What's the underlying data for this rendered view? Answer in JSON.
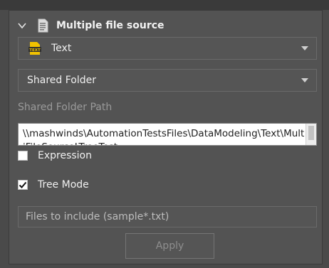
{
  "section": {
    "title": "Multiple file source",
    "collapse_icon": "chevron-down-icon",
    "title_icon": "document-icon"
  },
  "source_type": {
    "icon": "text-file-icon",
    "value": "Text"
  },
  "location_type": {
    "value": "Shared Folder"
  },
  "shared_folder": {
    "label": "Shared Folder Path",
    "value": "\\\\mashwinds\\AutomationTestsFiles\\DataModeling\\Text\\MultiFileSourceLTreeTest"
  },
  "options": {
    "expression": {
      "label": "Expression",
      "checked": false
    },
    "tree_mode": {
      "label": "Tree Mode",
      "checked": true
    }
  },
  "filter": {
    "placeholder": "Files to include (sample*.txt)"
  },
  "actions": {
    "apply_label": "Apply"
  },
  "colors": {
    "background": "#4a4a4a",
    "panel": "#535353",
    "text": "#f0f0f0",
    "muted": "#9a9a9a",
    "icon_yellow": "#f2c200"
  }
}
